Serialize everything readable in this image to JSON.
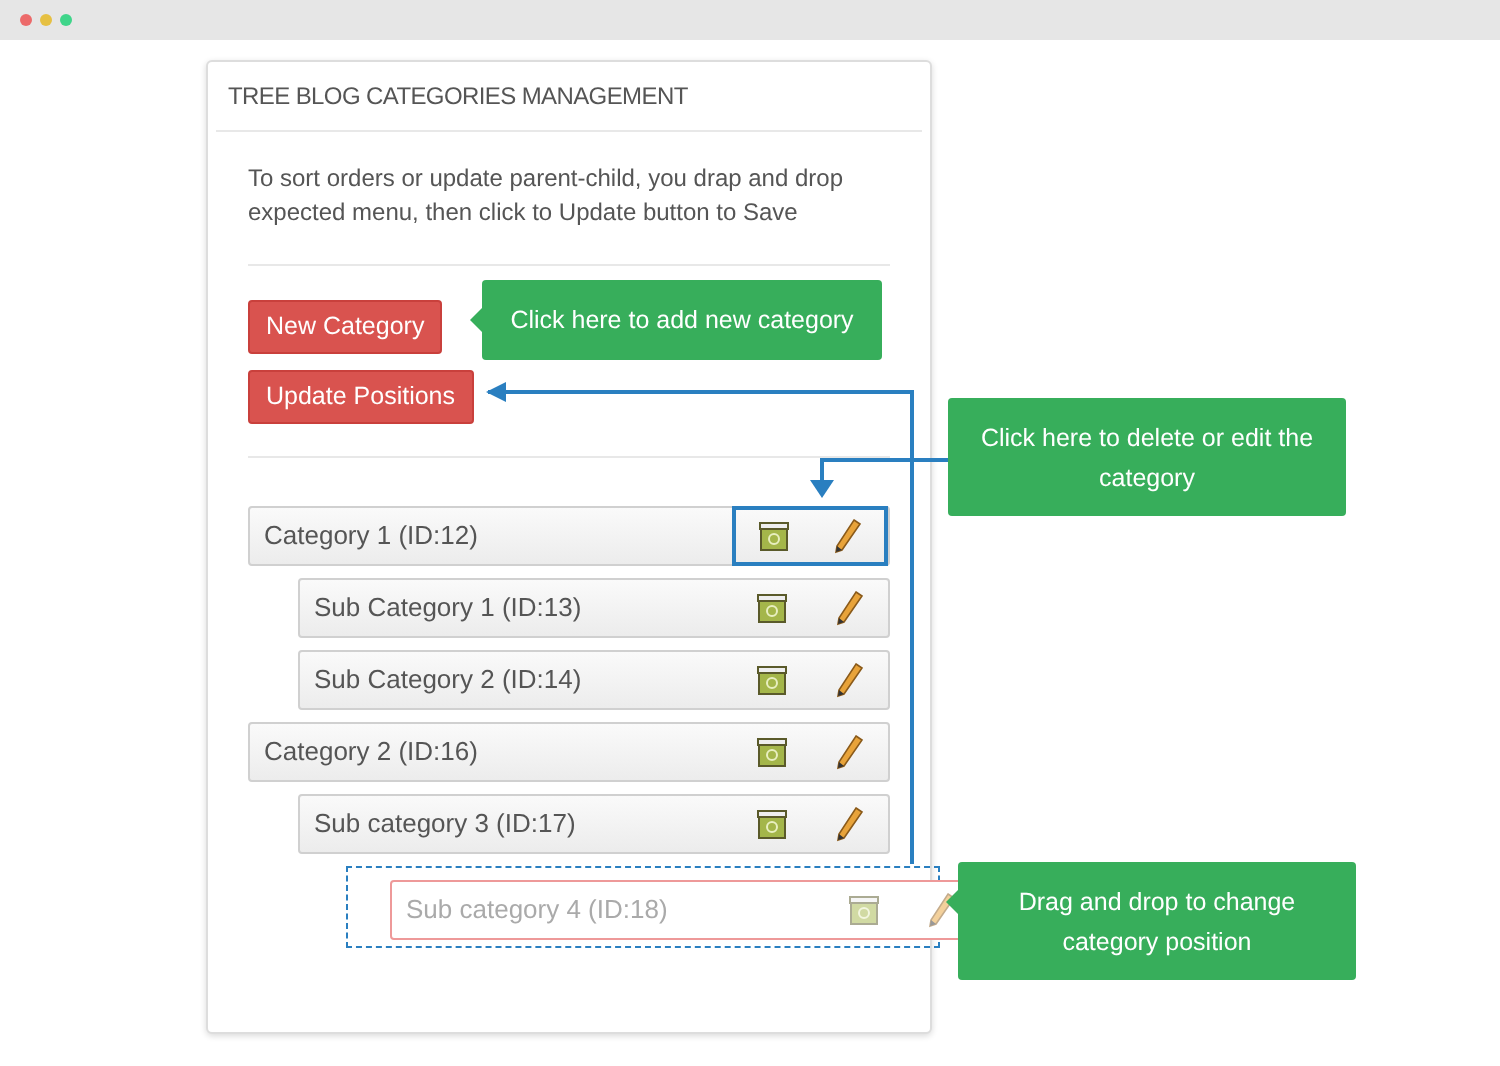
{
  "panel": {
    "title": "TREE BLOG CATEGORIES MANAGEMENT",
    "instructions": "To sort orders or update parent-child, you drap and drop expected menu, then click to Update button to Save",
    "buttons": [
      "New Category",
      "Update Positions"
    ]
  },
  "tree": [
    {
      "label": "Category 1 (ID:12)",
      "highlighted": true,
      "dragging": false,
      "children": [
        {
          "label": "Sub Category 1 (ID:13)",
          "highlighted": false,
          "dragging": false
        },
        {
          "label": "Sub Category 2 (ID:14)",
          "highlighted": false,
          "dragging": false
        }
      ]
    },
    {
      "label": "Category 2 (ID:16)",
      "highlighted": false,
      "dragging": false,
      "children": [
        {
          "label": "Sub category 3 (ID:17)",
          "highlighted": false,
          "dragging": false,
          "children": [
            {
              "label": "Sub category 4 (ID:18)",
              "highlighted": false,
              "dragging": true
            }
          ]
        }
      ]
    }
  ],
  "callouts": [
    "Click here to add new category",
    "Click here to delete or edit the category",
    "Drag and drop to change category position"
  ]
}
